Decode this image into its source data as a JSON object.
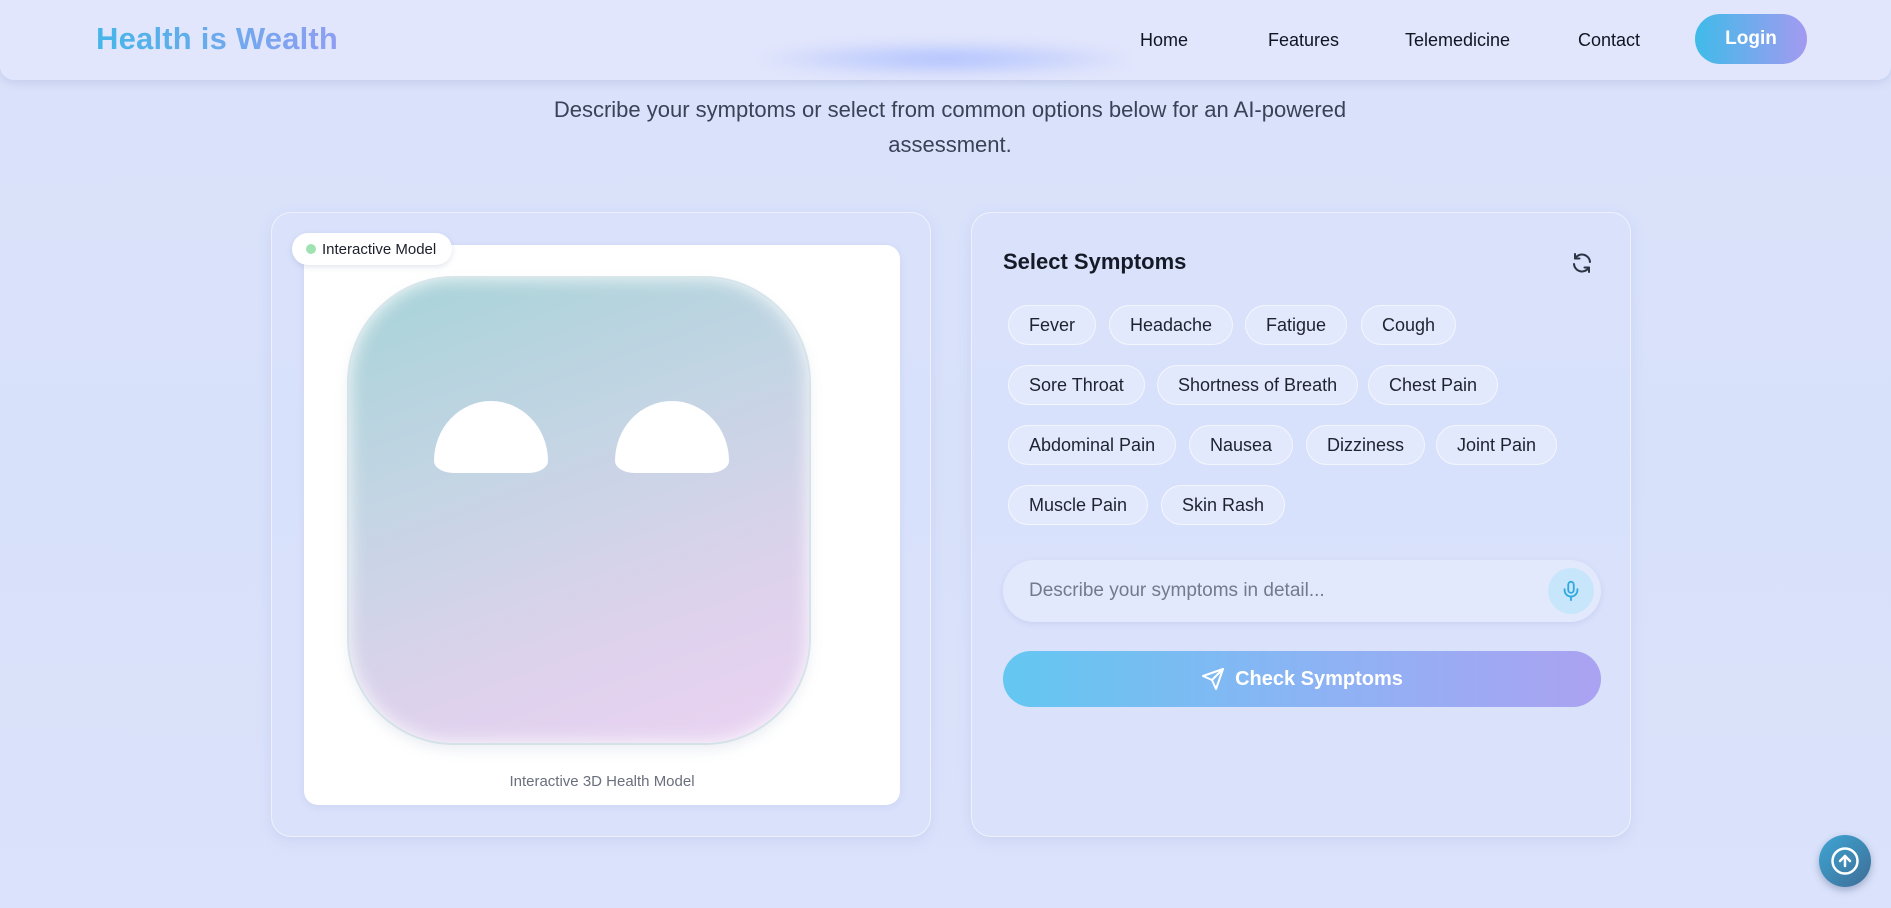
{
  "header": {
    "brand": "Health is Wealth",
    "nav": [
      {
        "label": "Home"
      },
      {
        "label": "Features"
      },
      {
        "label": "Telemedicine"
      },
      {
        "label": "Contact"
      }
    ],
    "login_label": "Login"
  },
  "intro": {
    "subtitle_line1": "Describe your symptoms or select from common options below for an AI-powered",
    "subtitle_line2": "assessment."
  },
  "model_panel": {
    "badge": "Interactive Model",
    "caption": "Interactive 3D Health Model"
  },
  "symptoms_panel": {
    "title": "Select Symptoms",
    "refresh_icon": "refresh-icon",
    "chips": [
      "Fever",
      "Headache",
      "Fatigue",
      "Cough",
      "Sore Throat",
      "Shortness of Breath",
      "Chest Pain",
      "Abdominal Pain",
      "Nausea",
      "Dizziness",
      "Joint Pain",
      "Muscle Pain",
      "Skin Rash"
    ],
    "input_placeholder": "Describe your symptoms in detail...",
    "mic_icon": "microphone-icon",
    "check_label": "Check Symptoms",
    "check_icon": "send-icon"
  },
  "scroll_top_icon": "arrow-up-circle-icon",
  "colors": {
    "brand_start": "#45b6e8",
    "brand_end": "#8f9ef2",
    "accent_start": "#63c7f1",
    "accent_end": "#aba2f2"
  }
}
